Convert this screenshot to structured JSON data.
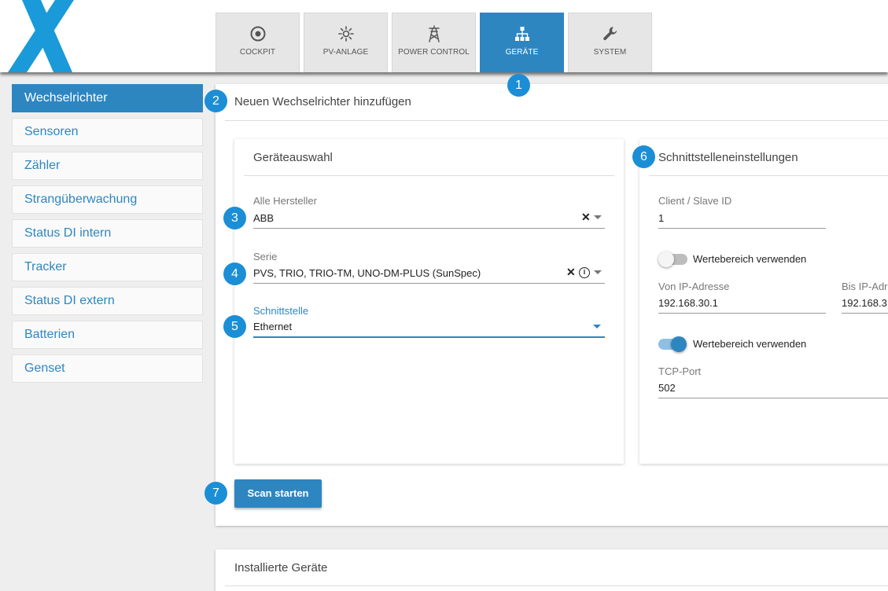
{
  "header": {
    "tabs": [
      {
        "label": "COCKPIT",
        "icon": "target-icon",
        "active": false
      },
      {
        "label": "PV-ANLAGE",
        "icon": "sun-icon",
        "active": false
      },
      {
        "label": "POWER CONTROL",
        "icon": "power-tower-icon",
        "active": false
      },
      {
        "label": "GERÄTE",
        "icon": "network-icon",
        "active": true
      },
      {
        "label": "SYSTEM",
        "icon": "wrench-icon",
        "active": false
      }
    ]
  },
  "badges": [
    "1",
    "2",
    "3",
    "4",
    "5",
    "6",
    "7"
  ],
  "sidebar": {
    "items": [
      {
        "label": "Wechselrichter",
        "active": true
      },
      {
        "label": "Sensoren"
      },
      {
        "label": "Zähler"
      },
      {
        "label": "Strangüberwachung"
      },
      {
        "label": "Status DI intern"
      },
      {
        "label": "Tracker"
      },
      {
        "label": "Status DI extern"
      },
      {
        "label": "Batterien"
      },
      {
        "label": "Genset"
      }
    ]
  },
  "main": {
    "title": "Neuen Wechselrichter hinzufügen",
    "device_card": {
      "title": "Geräteauswahl",
      "manufacturer": {
        "label": "Alle Hersteller",
        "value": "ABB"
      },
      "series": {
        "label": "Serie",
        "value": "PVS, TRIO, TRIO-TM, UNO-DM-PLUS (SunSpec)"
      },
      "interface": {
        "label": "Schnittstelle",
        "value": "Ethernet"
      },
      "clear_symbol": "✕",
      "info_symbol": "i"
    },
    "interface_card": {
      "title": "Schnittstelleneinstellungen",
      "client_id": {
        "label": "Client / Slave ID",
        "value": "1"
      },
      "range_toggle_1": {
        "label": "Wertebereich verwenden",
        "on": false
      },
      "from_ip": {
        "label": "Von IP-Adresse",
        "value": "192.168.30.1"
      },
      "to_ip": {
        "label": "Bis IP-Adr",
        "value": "192.168.3"
      },
      "range_toggle_2": {
        "label": "Wertebereich verwenden",
        "on": true
      },
      "tcp_port": {
        "label": "TCP-Port",
        "value": "502"
      }
    },
    "scan_button": "Scan starten"
  },
  "installed": {
    "title": "Installierte Geräte"
  },
  "colors": {
    "accent": "#2e86c1",
    "badge": "#1b8ed6",
    "logo": "#1a9ad9"
  }
}
